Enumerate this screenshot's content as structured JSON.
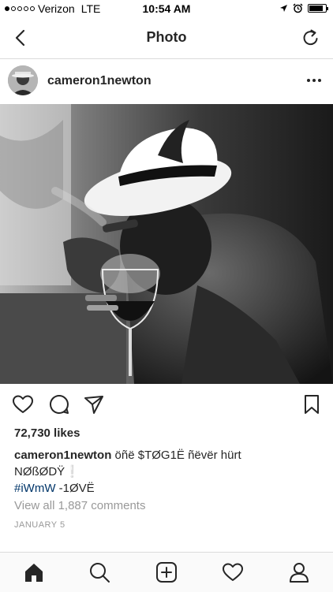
{
  "status_bar": {
    "carrier": "Verizon",
    "network": "LTE",
    "time": "10:54 AM",
    "signal_bars_filled": 1,
    "signal_bars_total": 5,
    "battery_level": 0.85
  },
  "nav": {
    "title": "Photo",
    "back_icon": "chevron-left-icon",
    "refresh_icon": "refresh-icon"
  },
  "post": {
    "username": "cameron1newton",
    "likes": "72,730 likes",
    "caption_username": "cameron1newton",
    "caption_line1": " öñë $TØG1Ë ñëvër hürt",
    "caption_line2": "NØßØDŸ",
    "caption_exclaim": "❕",
    "hashtag": "#iWmW",
    "caption_line3_rest": " -1ØVË",
    "comments": "View all 1,887 comments",
    "date": "JANUARY 5"
  },
  "colors": {
    "text": "#262626",
    "muted": "#999999",
    "hashtag": "#003569",
    "divider": "#dbdbdb"
  },
  "icons": {
    "like": "heart-icon",
    "comment": "comment-icon",
    "share": "send-icon",
    "save": "bookmark-icon",
    "more": "more-icon"
  },
  "tabs": [
    "home-icon",
    "search-icon",
    "add-icon",
    "activity-icon",
    "profile-icon"
  ]
}
